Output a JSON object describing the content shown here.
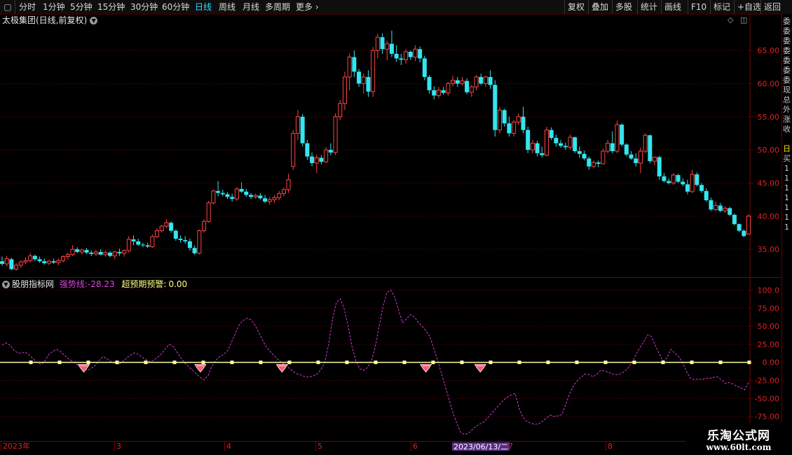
{
  "toolbar": {
    "left": [
      {
        "label": "分时",
        "active": false
      },
      {
        "label": "1分钟",
        "active": false
      },
      {
        "label": "5分钟",
        "active": false
      },
      {
        "label": "15分钟",
        "active": false
      },
      {
        "label": "30分钟",
        "active": false
      },
      {
        "label": "60分钟",
        "active": false
      },
      {
        "label": "日线",
        "active": true
      },
      {
        "label": "周线",
        "active": false
      },
      {
        "label": "月线",
        "active": false
      },
      {
        "label": "多周期",
        "active": false
      },
      {
        "label": "更多",
        "active": false
      }
    ],
    "right": [
      "复权",
      "叠加",
      "多股",
      "统计",
      "画线",
      "F10",
      "标记",
      "+自选",
      "返回"
    ]
  },
  "main_title": "太极集团(日线,前复权)",
  "indicator": {
    "name": "股朋指标网",
    "strong_label": "强势线:",
    "strong_value": "-28.23",
    "warn_label": "超预期预警:",
    "warn_value": "0.00"
  },
  "colors": {
    "up": "#ff4444",
    "down": "#32e6f0",
    "grid": "#7a0000",
    "strong_line": "#d23cd2",
    "zero_line": "#ffffa0",
    "warning_marker": "#ff5a6e",
    "axis_text": "#e02020"
  },
  "date_axis": {
    "labels": [
      "2023年",
      "3",
      "4",
      "5",
      "6",
      "7",
      "8"
    ],
    "highlight": "2023/06/13/二"
  },
  "right_panel_chars": [
    "委",
    "委",
    "委",
    "委",
    "委",
    "委",
    "委",
    "现",
    "总",
    "外",
    "涨",
    "收",
    "",
    "",
    "日",
    "买",
    "1",
    "1",
    "1",
    "1",
    "1",
    "1",
    "1"
  ],
  "watermark": {
    "line1": "乐淘公式网",
    "line2": "www.60lt.com"
  },
  "chart_data": [
    {
      "type": "candlestick",
      "title": "太极集团(日线,前复权)",
      "ylim": [
        31,
        68.6
      ],
      "yticks": [
        "65.00",
        "60.00",
        "55.00",
        "50.00",
        "45.00",
        "40.00",
        "35.00"
      ],
      "candles_note": "open, high, low, close per trading day (estimated from image)",
      "candles": [
        [
          33.2,
          33.9,
          32.5,
          32.8
        ],
        [
          32.8,
          34.0,
          32.4,
          33.6
        ],
        [
          33.5,
          33.7,
          31.9,
          32.0
        ],
        [
          32.0,
          32.9,
          31.8,
          32.6
        ],
        [
          32.6,
          33.3,
          32.2,
          33.1
        ],
        [
          33.1,
          33.8,
          32.8,
          33.3
        ],
        [
          33.3,
          34.4,
          33.0,
          34.0
        ],
        [
          34.0,
          34.2,
          33.2,
          33.5
        ],
        [
          33.5,
          33.9,
          33.0,
          33.2
        ],
        [
          33.2,
          33.6,
          32.7,
          32.9
        ],
        [
          32.9,
          33.4,
          32.6,
          33.2
        ],
        [
          33.2,
          33.6,
          32.8,
          33.0
        ],
        [
          33.0,
          33.6,
          32.6,
          33.3
        ],
        [
          33.3,
          34.1,
          33.0,
          33.9
        ],
        [
          33.9,
          34.5,
          33.5,
          34.2
        ],
        [
          34.2,
          35.6,
          34.0,
          35.0
        ],
        [
          35.0,
          35.3,
          34.4,
          34.6
        ],
        [
          34.6,
          35.1,
          34.2,
          34.9
        ],
        [
          34.9,
          35.2,
          34.3,
          34.5
        ],
        [
          34.5,
          34.8,
          34.0,
          34.3
        ],
        [
          34.3,
          34.9,
          34.0,
          34.6
        ],
        [
          34.6,
          35.0,
          34.1,
          34.2
        ],
        [
          34.2,
          34.8,
          33.9,
          34.5
        ],
        [
          34.5,
          34.7,
          33.8,
          34.0
        ],
        [
          34.0,
          34.8,
          33.5,
          34.6
        ],
        [
          34.6,
          35.1,
          34.0,
          34.4
        ],
        [
          34.4,
          35.0,
          33.9,
          34.8
        ],
        [
          34.8,
          37.0,
          34.5,
          36.5
        ],
        [
          36.5,
          37.1,
          35.6,
          36.2
        ],
        [
          36.2,
          36.6,
          35.5,
          35.7
        ],
        [
          35.7,
          36.0,
          35.3,
          35.6
        ],
        [
          35.6,
          36.0,
          35.2,
          35.4
        ],
        [
          35.4,
          37.2,
          35.2,
          36.9
        ],
        [
          36.9,
          38.2,
          36.7,
          37.8
        ],
        [
          37.8,
          38.7,
          37.5,
          38.5
        ],
        [
          38.5,
          39.5,
          38.2,
          39.0
        ],
        [
          39.0,
          39.2,
          37.5,
          37.8
        ],
        [
          37.8,
          38.0,
          36.3,
          36.6
        ],
        [
          36.6,
          37.1,
          36.0,
          36.4
        ],
        [
          36.4,
          37.0,
          35.9,
          36.2
        ],
        [
          36.2,
          36.6,
          34.8,
          35.2
        ],
        [
          35.2,
          35.6,
          34.2,
          34.4
        ],
        [
          34.4,
          38.0,
          34.2,
          37.8
        ],
        [
          37.8,
          39.5,
          37.5,
          39.2
        ],
        [
          39.2,
          42.3,
          39.0,
          42.0
        ],
        [
          42.0,
          44.0,
          41.8,
          43.8
        ],
        [
          43.8,
          45.3,
          43.0,
          43.5
        ],
        [
          43.5,
          44.0,
          43.0,
          43.3
        ],
        [
          43.3,
          43.6,
          42.6,
          42.9
        ],
        [
          42.9,
          43.4,
          42.2,
          42.6
        ],
        [
          42.6,
          44.4,
          42.3,
          44.1
        ],
        [
          44.1,
          45.1,
          43.5,
          43.7
        ],
        [
          43.7,
          44.1,
          42.9,
          43.2
        ],
        [
          43.2,
          43.5,
          42.6,
          42.9
        ],
        [
          42.9,
          43.4,
          42.6,
          43.1
        ],
        [
          43.1,
          43.5,
          42.5,
          42.7
        ],
        [
          42.7,
          43.2,
          42.0,
          42.2
        ],
        [
          42.2,
          42.9,
          41.7,
          42.5
        ],
        [
          42.5,
          43.2,
          42.0,
          42.8
        ],
        [
          42.8,
          43.8,
          42.4,
          43.4
        ],
        [
          43.4,
          44.3,
          43.0,
          44.0
        ],
        [
          44.0,
          46.4,
          43.5,
          45.5
        ],
        [
          47.5,
          53.0,
          47.0,
          52.5
        ],
        [
          52.5,
          56.0,
          51.5,
          55.0
        ],
        [
          55.0,
          55.4,
          50.5,
          51.0
        ],
        [
          51.0,
          51.5,
          48.5,
          49.0
        ],
        [
          49.0,
          49.6,
          47.5,
          48.0
        ],
        [
          48.0,
          49.3,
          46.5,
          48.8
        ],
        [
          48.8,
          49.2,
          47.8,
          48.2
        ],
        [
          48.2,
          50.4,
          48.0,
          50.0
        ],
        [
          50.0,
          51.0,
          49.2,
          49.6
        ],
        [
          49.6,
          55.5,
          49.2,
          55.0
        ],
        [
          55.0,
          57.5,
          54.5,
          57.0
        ],
        [
          57.0,
          61.8,
          56.0,
          61.0
        ],
        [
          61.0,
          64.5,
          59.0,
          64.0
        ],
        [
          64.0,
          65.0,
          61.0,
          61.8
        ],
        [
          61.8,
          62.2,
          59.5,
          60.0
        ],
        [
          60.0,
          61.5,
          58.5,
          61.0
        ],
        [
          61.0,
          62.0,
          58.0,
          58.8
        ],
        [
          58.8,
          65.5,
          58.0,
          65.0
        ],
        [
          65.0,
          67.5,
          63.8,
          67.0
        ],
        [
          67.0,
          67.6,
          64.5,
          65.2
        ],
        [
          65.2,
          66.5,
          63.5,
          66.0
        ],
        [
          66.0,
          68.0,
          64.0,
          64.5
        ],
        [
          64.5,
          65.8,
          63.3,
          63.8
        ],
        [
          63.8,
          64.5,
          62.8,
          63.6
        ],
        [
          63.6,
          65.2,
          63.0,
          64.8
        ],
        [
          64.8,
          65.0,
          63.6,
          64.0
        ],
        [
          64.0,
          65.8,
          63.4,
          65.2
        ],
        [
          65.2,
          65.6,
          63.2,
          63.8
        ],
        [
          63.8,
          64.2,
          60.5,
          61.0
        ],
        [
          61.0,
          61.3,
          58.5,
          59.0
        ],
        [
          59.0,
          59.6,
          57.6,
          58.2
        ],
        [
          58.2,
          59.5,
          57.8,
          59.0
        ],
        [
          59.0,
          59.5,
          58.3,
          58.6
        ],
        [
          58.6,
          60.3,
          58.2,
          60.0
        ],
        [
          60.0,
          61.2,
          59.6,
          60.5
        ],
        [
          60.5,
          61.0,
          59.5,
          60.0
        ],
        [
          60.0,
          61.0,
          59.7,
          60.4
        ],
        [
          60.4,
          60.8,
          58.4,
          58.7
        ],
        [
          58.7,
          59.8,
          58.0,
          59.5
        ],
        [
          59.5,
          61.3,
          59.0,
          61.0
        ],
        [
          61.0,
          61.5,
          59.8,
          60.0
        ],
        [
          60.0,
          61.2,
          59.5,
          61.0
        ],
        [
          61.0,
          62.0,
          59.2,
          59.8
        ],
        [
          59.8,
          60.5,
          52.0,
          53.0
        ],
        [
          53.0,
          56.5,
          52.5,
          56.0
        ],
        [
          56.0,
          56.2,
          53.5,
          54.0
        ],
        [
          54.0,
          55.0,
          52.0,
          52.5
        ],
        [
          52.5,
          54.5,
          52.0,
          54.2
        ],
        [
          54.2,
          55.5,
          53.8,
          55.0
        ],
        [
          55.0,
          56.5,
          52.5,
          53.0
        ],
        [
          53.0,
          53.5,
          49.5,
          50.0
        ],
        [
          50.0,
          51.5,
          49.5,
          51.0
        ],
        [
          51.0,
          51.4,
          49.0,
          49.5
        ],
        [
          49.5,
          50.5,
          48.9,
          49.2
        ],
        [
          49.2,
          53.5,
          49.0,
          53.0
        ],
        [
          53.0,
          53.4,
          51.5,
          51.8
        ],
        [
          51.8,
          52.3,
          50.5,
          51.0
        ],
        [
          51.0,
          51.5,
          50.3,
          50.6
        ],
        [
          50.6,
          51.1,
          50.0,
          50.4
        ],
        [
          50.4,
          52.3,
          50.0,
          51.9
        ],
        [
          51.9,
          52.0,
          49.5,
          49.8
        ],
        [
          49.8,
          50.5,
          48.8,
          49.4
        ],
        [
          49.4,
          49.9,
          48.4,
          48.7
        ],
        [
          48.7,
          49.0,
          47.0,
          47.5
        ],
        [
          47.5,
          48.4,
          47.2,
          48.1
        ],
        [
          48.1,
          48.4,
          47.4,
          47.9
        ],
        [
          47.9,
          50.2,
          47.8,
          49.8
        ],
        [
          49.8,
          51.5,
          49.5,
          51.0
        ],
        [
          51.0,
          52.8,
          49.5,
          49.8
        ],
        [
          49.8,
          54.4,
          49.5,
          53.8
        ],
        [
          53.8,
          54.0,
          50.5,
          50.8
        ],
        [
          50.8,
          51.0,
          49.0,
          49.3
        ],
        [
          49.3,
          49.8,
          48.5,
          48.7
        ],
        [
          48.7,
          49.5,
          47.5,
          48.0
        ],
        [
          48.0,
          50.3,
          46.5,
          49.8
        ],
        [
          49.8,
          52.5,
          49.5,
          52.2
        ],
        [
          52.2,
          52.3,
          48.0,
          48.3
        ],
        [
          48.3,
          49.0,
          47.7,
          48.9
        ],
        [
          48.9,
          49.1,
          45.5,
          46.0
        ],
        [
          46.0,
          46.5,
          45.1,
          45.3
        ],
        [
          45.3,
          45.7,
          44.8,
          45.0
        ],
        [
          45.0,
          46.5,
          44.7,
          46.2
        ],
        [
          46.2,
          46.4,
          45.0,
          45.2
        ],
        [
          45.2,
          45.7,
          44.5,
          44.8
        ],
        [
          44.8,
          45.5,
          43.3,
          43.7
        ],
        [
          43.7,
          47.0,
          43.5,
          46.3
        ],
        [
          46.3,
          46.6,
          44.5,
          44.7
        ],
        [
          44.7,
          45.0,
          43.5,
          43.8
        ],
        [
          43.8,
          44.2,
          42.2,
          42.4
        ],
        [
          42.4,
          42.8,
          40.8,
          41.0
        ],
        [
          41.0,
          42.2,
          40.7,
          41.6
        ],
        [
          41.6,
          42.0,
          40.6,
          40.8
        ],
        [
          40.8,
          41.5,
          40.5,
          41.2
        ],
        [
          41.2,
          41.4,
          40.0,
          40.2
        ],
        [
          40.2,
          40.4,
          38.6,
          38.8
        ],
        [
          38.8,
          38.9,
          37.6,
          37.8
        ],
        [
          37.8,
          38.0,
          36.8,
          37.0
        ],
        [
          37.3,
          40.3,
          37.2,
          40.0
        ]
      ]
    },
    {
      "type": "line",
      "title": "股朋指标网",
      "ylim": [
        -105,
        115
      ],
      "yticks": [
        "100.0",
        "75.00",
        "50.00",
        "25.00",
        "0.00",
        "-25.00",
        "-50.00",
        "-75.00"
      ],
      "series": [
        {
          "name": "强势线",
          "values": [
            24,
            27,
            24,
            17,
            13,
            13,
            14,
            10,
            5,
            0,
            -3,
            2,
            11,
            15,
            18,
            15,
            10,
            5,
            2,
            -2,
            -6,
            -9,
            -11,
            -8,
            -4,
            3,
            8,
            5,
            1,
            -1,
            -3,
            1,
            6,
            10,
            13,
            11,
            7,
            4,
            1,
            3,
            7,
            12,
            19,
            25,
            22,
            14,
            6,
            -1,
            -6,
            -11,
            -16,
            -21,
            -24,
            -18,
            -5,
            3,
            8,
            11,
            16,
            28,
            40,
            52,
            58,
            61,
            59,
            52,
            42,
            31,
            21,
            15,
            9,
            4,
            -1,
            -4,
            -9,
            -13,
            -16,
            -18,
            -20,
            -20,
            -19,
            -16,
            -10,
            0,
            25,
            60,
            83,
            88,
            74,
            50,
            22,
            2,
            -9,
            -11,
            -7,
            2,
            22,
            50,
            78,
            97,
            100,
            90,
            72,
            55,
            60,
            66,
            63,
            56,
            50,
            44,
            36,
            20,
            3,
            -15,
            -33,
            -52,
            -70,
            -85,
            -97,
            -100,
            -98,
            -93,
            -88,
            -85,
            -82,
            -76,
            -70,
            -64,
            -58,
            -52,
            -48,
            -45,
            -43,
            -64,
            -76,
            -82,
            -84,
            -86,
            -85,
            -82,
            -77,
            -73,
            -75,
            -74,
            -72,
            -58,
            -43,
            -32,
            -25,
            -20,
            -16,
            -17,
            -20,
            -16,
            -11,
            -12,
            -14,
            -16,
            -17,
            -16,
            -13,
            -8,
            0,
            10,
            20,
            28,
            38,
            36,
            24,
            12,
            2,
            6,
            18,
            13,
            8,
            0,
            -12,
            -22,
            -24,
            -23,
            -24,
            -22,
            -22,
            -21,
            -20,
            -24,
            -29,
            -28,
            -30,
            -33,
            -35,
            -38,
            -28
          ]
        }
      ],
      "zero_line_value": 0,
      "warning_indices": [
        21,
        51,
        72,
        109,
        123,
        219
      ]
    }
  ]
}
